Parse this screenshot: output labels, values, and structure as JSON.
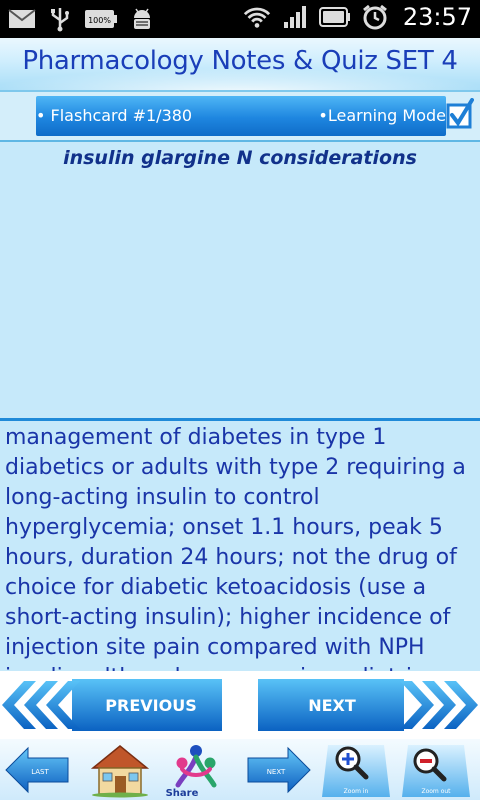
{
  "status_bar": {
    "battery_percent": "100%",
    "time": "23:57",
    "icons": [
      "mail-icon",
      "usb-icon",
      "battery-icon",
      "android-debug-icon",
      "wifi-icon",
      "signal-icon",
      "battery-status-icon",
      "alarm-icon"
    ]
  },
  "header": {
    "title": "Pharmacology Notes & Quiz SET 4"
  },
  "card_bar": {
    "flashcard_label": "• Flashcard #1/380",
    "mode_label": "•Learning Mode",
    "checkbox_checked": true
  },
  "question": {
    "text": "insulin glargine N considerations"
  },
  "answer": {
    "text": "management of diabetes in type 1 diabetics or adults with type 2 requiring a long-acting insulin to control hyperglycemia; onset 1.1 hours, peak 5 hours, duration 24 hours; not the drug of choice for diabetic ketoacidosis (use a short-acting insulin); higher incidence of injection site pain compared with NPH insulin; although rare, use in pediatrics"
  },
  "nav": {
    "previous_label": "PREVIOUS",
    "next_label": "NEXT"
  },
  "toolbar": {
    "last_label": "LAST",
    "share_label": "Share",
    "next_label": "NEXT",
    "zoom_in_label": "Zoom in",
    "zoom_out_label": "Zoom out"
  },
  "colors": {
    "accent_blue": "#1e86e0",
    "title_text": "#1a3eb8",
    "answer_text": "#1a35a8",
    "panel_bg": "#c6e9fa"
  }
}
